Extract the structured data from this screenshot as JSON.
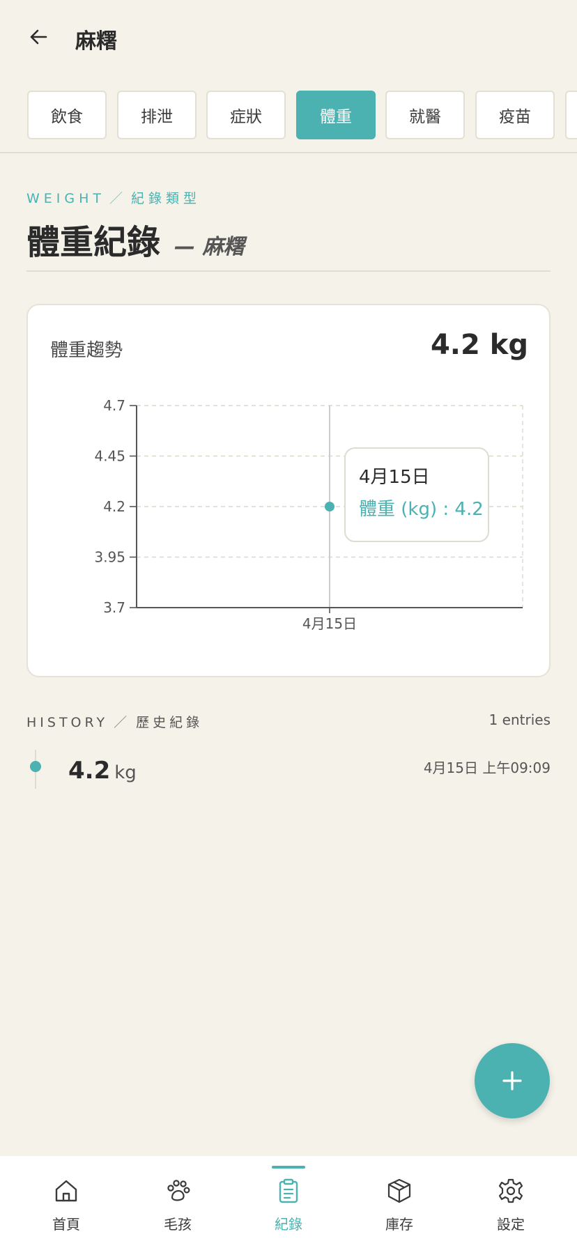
{
  "app_bar": {
    "title": "麻糬"
  },
  "tabs": [
    {
      "label": "飲食",
      "active": false
    },
    {
      "label": "排泄",
      "active": false
    },
    {
      "label": "症狀",
      "active": false
    },
    {
      "label": "體重",
      "active": true
    },
    {
      "label": "就醫",
      "active": false
    },
    {
      "label": "疫苗",
      "active": false
    }
  ],
  "section": {
    "eyebrow_en": "WEIGHT",
    "eyebrow_sep": "／",
    "eyebrow_zh": "紀錄類型",
    "title": "體重紀錄",
    "subtitle": "— 麻糬"
  },
  "card": {
    "label": "體重趨勢",
    "value": "4.2 kg"
  },
  "chart_data": {
    "type": "line",
    "x": [
      "4月15日"
    ],
    "series": [
      {
        "name": "體重 (kg)",
        "values": [
          4.2
        ]
      }
    ],
    "ylim": [
      3.7,
      4.7
    ],
    "yticks": [
      "4.7",
      "4.45",
      "4.2",
      "3.95",
      "3.7"
    ],
    "grid": true,
    "tooltip": {
      "title": "4月15日",
      "text": "體重 (kg) : 4.2"
    }
  },
  "history": {
    "eyebrow_en": "HISTORY",
    "eyebrow_sep": "／",
    "eyebrow_zh": "歷史紀錄",
    "count": "1 entries",
    "entries": [
      {
        "value": "4.2",
        "unit": "kg",
        "date": "4月15日 上午09:09"
      }
    ]
  },
  "nav": [
    {
      "label": "首頁",
      "icon": "home-icon",
      "active": false
    },
    {
      "label": "毛孩",
      "icon": "paw-icon",
      "active": false
    },
    {
      "label": "紀錄",
      "icon": "clipboard-icon",
      "active": true
    },
    {
      "label": "庫存",
      "icon": "box-icon",
      "active": false
    },
    {
      "label": "設定",
      "icon": "gear-icon",
      "active": false
    }
  ],
  "colors": {
    "accent": "#4bb1b1",
    "background": "#f4f2e9"
  }
}
